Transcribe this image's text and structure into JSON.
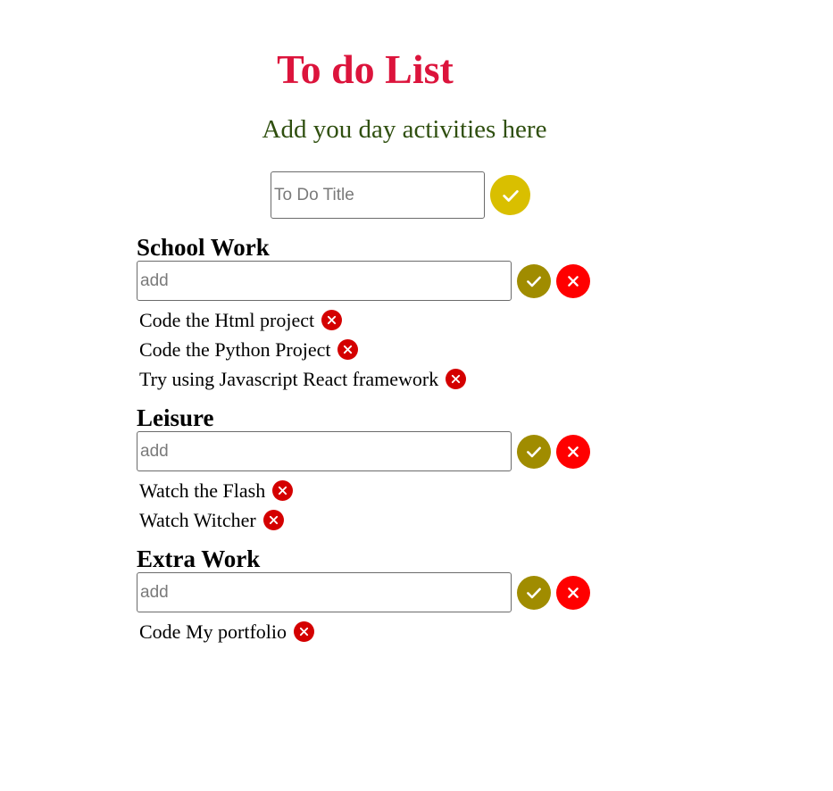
{
  "header": {
    "title": "To do List",
    "subtitle": "Add you day activities here"
  },
  "new_todo": {
    "placeholder": "To Do Title",
    "add_icon": "check-icon"
  },
  "colors": {
    "title": "#dc143c",
    "subtitle": "#2f4f0f",
    "main_add_button": "#d9bf00",
    "category_add_button": "#a08c00",
    "category_delete_button": "#ff0000",
    "item_delete_icon": "#d40000"
  },
  "categories": [
    {
      "title": "School Work",
      "input_placeholder": "add",
      "items": [
        "Code the Html project",
        "Code the Python Project",
        "Try using Javascript React framework"
      ]
    },
    {
      "title": "Leisure",
      "input_placeholder": "add",
      "items": [
        "Watch the Flash",
        "Watch Witcher"
      ]
    },
    {
      "title": "Extra Work",
      "input_placeholder": "add",
      "items": [
        "Code My portfolio"
      ]
    }
  ]
}
